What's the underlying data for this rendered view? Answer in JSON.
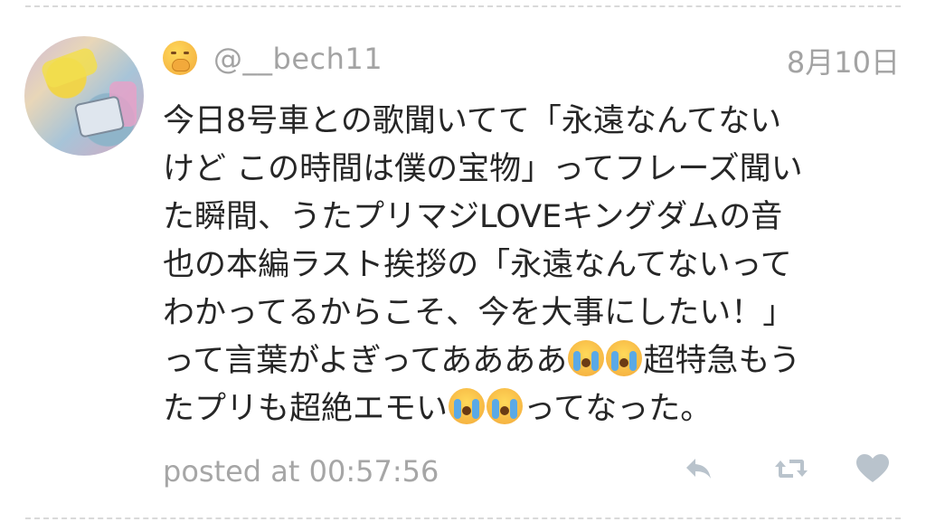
{
  "tweet": {
    "username": "@__bech11",
    "date": "8月10日",
    "user_emoji": "face-with-hand-over-mouth-icon",
    "lines": [
      [
        "今日8号車との歌聞いてて「永遠なんてない"
      ],
      [
        "けど この時間は僕の宝物」ってフレーズ聞い"
      ],
      [
        "た瞬間、うたプリマジLOVEキングダムの音"
      ],
      [
        "也の本編ラスト挨拶の「永遠なんてないって"
      ],
      [
        "わかってるからこそ、今を大事にしたい！」"
      ],
      [
        "って言葉がよぎってああああ",
        "超特急もう"
      ],
      [
        "たプリも超絶エモい",
        "ってなった。"
      ]
    ],
    "posted": "posted at 00:57:56"
  },
  "actions": {
    "reply": "reply-icon",
    "retweet": "retweet-icon",
    "like": "heart-icon"
  },
  "colors": {
    "text": "#262626",
    "muted": "#a3a3a3",
    "icon": "#b9c3cc"
  }
}
